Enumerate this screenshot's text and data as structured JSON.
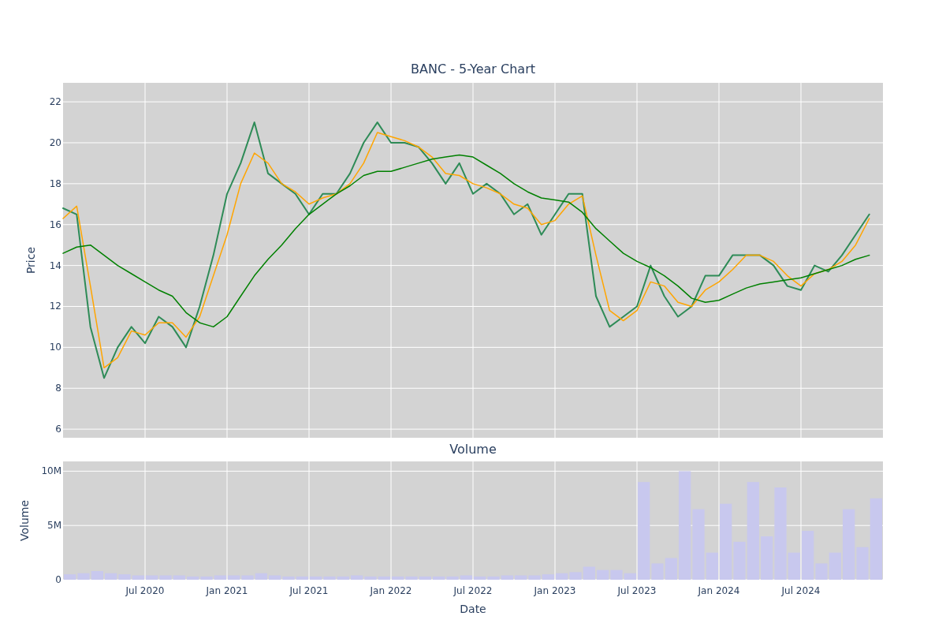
{
  "page": {
    "title": "BANC - 5-Year Chart"
  },
  "price_chart": {
    "chart_data": {
      "type": "line",
      "ylabel": "Price",
      "grid": true,
      "categories": [
        null,
        null,
        null,
        null,
        null,
        null,
        null,
        null,
        null,
        null,
        null,
        null,
        null,
        null,
        null,
        null,
        null,
        null,
        null,
        null,
        null,
        null,
        null,
        null,
        null,
        null,
        null,
        null,
        null,
        null,
        null,
        null,
        null,
        null,
        null,
        null,
        null,
        null,
        null,
        null,
        null,
        null,
        null,
        null,
        null,
        null,
        null,
        null,
        null,
        null,
        null,
        null,
        null,
        null,
        null,
        null,
        null,
        null,
        null,
        null
      ],
      "series": [
        {
          "color": "#2e8b57",
          "values": [
            16.8,
            16.5,
            11,
            8.5,
            10,
            11,
            10.2,
            11.5,
            11,
            10,
            12,
            14.5,
            17.5,
            19,
            21,
            18.5,
            18,
            17.5,
            16.5,
            17.5,
            17.5,
            18.5,
            20,
            21,
            20,
            20,
            19.8,
            19,
            18,
            19,
            17.5,
            18,
            17.5,
            16.5,
            17,
            15.5,
            16.5,
            17.5,
            17.5,
            12.5,
            11,
            11.5,
            12,
            14,
            12.5,
            11.5,
            12,
            13.5,
            13.5,
            14.5,
            14.5,
            14.5,
            14,
            13,
            12.8,
            14,
            13.7,
            14.5,
            15.5,
            16.5
          ]
        },
        {
          "color": "#ffa500",
          "values": [
            16.3,
            16.9,
            13,
            9,
            9.5,
            10.8,
            10.6,
            11.2,
            11.2,
            10.5,
            11.5,
            13.5,
            15.5,
            18,
            19.5,
            19,
            18,
            17.6,
            17,
            17.3,
            17.5,
            18,
            19,
            20.5,
            20.3,
            20.1,
            19.8,
            19.3,
            18.5,
            18.4,
            18,
            17.8,
            17.5,
            17,
            16.8,
            16,
            16.2,
            17,
            17.4,
            14.5,
            11.8,
            11.3,
            11.8,
            13.2,
            13,
            12.2,
            12,
            12.8,
            13.2,
            13.8,
            14.5,
            14.5,
            14.2,
            13.5,
            13,
            13.6,
            13.8,
            14.2,
            15,
            16.3
          ]
        },
        {
          "color": "#008000",
          "values": [
            14.6,
            14.9,
            15,
            14.5,
            14,
            13.6,
            13.2,
            12.8,
            12.5,
            11.7,
            11.2,
            11,
            11.5,
            12.5,
            13.5,
            14.3,
            15,
            15.8,
            16.5,
            17,
            17.5,
            17.9,
            18.4,
            18.6,
            18.6,
            18.8,
            19,
            19.2,
            19.3,
            19.4,
            19.3,
            18.9,
            18.5,
            18,
            17.6,
            17.3,
            17.2,
            17.1,
            16.6,
            15.8,
            15.2,
            14.6,
            14.2,
            13.9,
            13.5,
            13,
            12.4,
            12.2,
            12.3,
            12.6,
            12.9,
            13.1,
            13.2,
            13.3,
            13.4,
            13.6,
            13.8,
            14,
            14.3,
            14.5
          ]
        }
      ],
      "ylim": [
        5.58,
        22.93
      ],
      "yticks": [
        6,
        8,
        10,
        12,
        14,
        16,
        18,
        20,
        22
      ]
    }
  },
  "volume_chart": {
    "chart_data": {
      "type": "bar",
      "title": "Volume",
      "xlabel": "Date",
      "ylabel": "Volume",
      "grid": true,
      "categories": [
        null,
        null,
        null,
        null,
        null,
        null,
        "Jul 2020",
        null,
        null,
        null,
        null,
        null,
        "Jan 2021",
        null,
        null,
        null,
        null,
        null,
        "Jul 2021",
        null,
        null,
        null,
        null,
        null,
        "Jan 2022",
        null,
        null,
        null,
        null,
        null,
        "Jul 2022",
        null,
        null,
        null,
        null,
        null,
        "Jan 2023",
        null,
        null,
        null,
        null,
        null,
        "Jul 2023",
        null,
        null,
        null,
        null,
        null,
        "Jan 2024",
        null,
        null,
        null,
        null,
        null,
        "Jul 2024",
        null,
        null,
        null,
        null,
        null
      ],
      "values": [
        500000,
        600000,
        800000,
        600000,
        500000,
        400000,
        400000,
        400000,
        400000,
        300000,
        300000,
        400000,
        400000,
        400000,
        600000,
        400000,
        300000,
        300000,
        300000,
        300000,
        300000,
        400000,
        300000,
        300000,
        300000,
        300000,
        300000,
        300000,
        300000,
        400000,
        300000,
        300000,
        400000,
        400000,
        400000,
        500000,
        600000,
        700000,
        1200000,
        900000,
        900000,
        600000,
        9000000,
        1500000,
        2000000,
        10000000,
        6500000,
        2500000,
        7000000,
        3500000,
        9000000,
        4000000,
        8500000,
        2500000,
        4500000,
        1500000,
        2500000,
        6500000,
        3000000,
        7500000
      ],
      "ylim": [
        0,
        10900000
      ],
      "yticks": [
        {
          "value": 0,
          "label": "0"
        },
        {
          "value": 5000000,
          "label": "5M"
        },
        {
          "value": 10000000,
          "label": "10M"
        }
      ]
    }
  }
}
